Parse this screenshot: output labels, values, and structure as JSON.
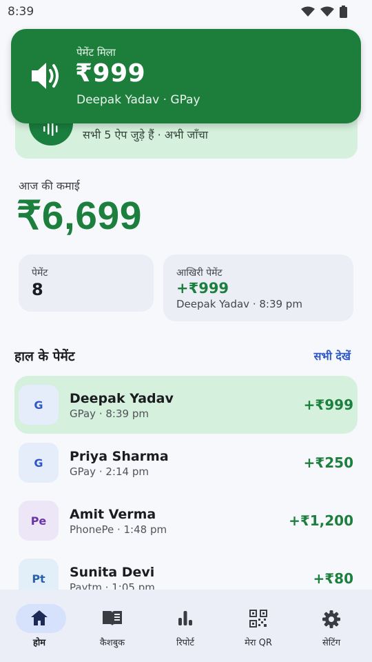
{
  "status_bar": {
    "time": "8:39"
  },
  "banner": {
    "title": "पेमेंट मिला",
    "amount": "₹999",
    "subtitle": "Deepak Yadav · GPay",
    "icon": "speaker-icon"
  },
  "listener": {
    "status": "सभी 5 ऐप जुड़े हैं · अभी जाँचा",
    "icon": "sound-wave-icon"
  },
  "earnings": {
    "label": "आज की कमाई",
    "amount": "₹6,699"
  },
  "stats": {
    "count_label": "पेमेंट",
    "count_value": "8",
    "last_label": "आखिरी पेमेंट",
    "last_amount": "+₹999",
    "last_sub": "Deepak Yadav · 8:39 pm"
  },
  "recent": {
    "title": "हाल के पेमेंट",
    "see_all": "सभी देखें",
    "items": [
      {
        "avatar": "G",
        "name": "Deepak Yadav",
        "sub": "GPay · 8:39 pm",
        "amount": "+₹999"
      },
      {
        "avatar": "G",
        "name": "Priya Sharma",
        "sub": "GPay · 2:14 pm",
        "amount": "+₹250"
      },
      {
        "avatar": "Pe",
        "name": "Amit Verma",
        "sub": "PhonePe · 1:48 pm",
        "amount": "+₹1,200"
      },
      {
        "avatar": "Pt",
        "name": "Sunita Devi",
        "sub": "Paytm · 1:05 pm",
        "amount": "+₹80"
      }
    ]
  },
  "nav": {
    "items": [
      {
        "label": "होम",
        "icon": "home-icon"
      },
      {
        "label": "कैशबुक",
        "icon": "book-icon"
      },
      {
        "label": "रिपोर्ट",
        "icon": "bar-chart-icon"
      },
      {
        "label": "मेरा QR",
        "icon": "qr-code-icon"
      },
      {
        "label": "सेटिंग",
        "icon": "gear-icon"
      }
    ]
  },
  "colors": {
    "brand_green": "#1d7e3c",
    "highlight_green": "#d5f0dc",
    "link_blue": "#2f58c4",
    "nav_active": "#d6e2fb"
  }
}
